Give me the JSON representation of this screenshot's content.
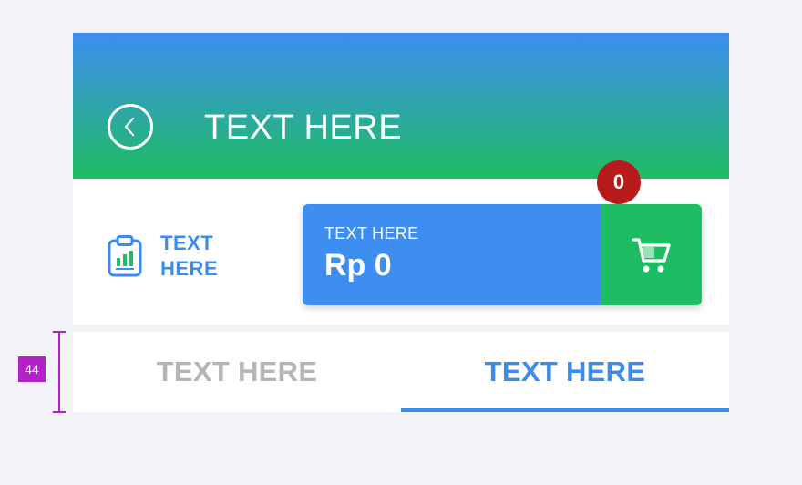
{
  "header": {
    "title": "TEXT HERE",
    "back_icon": "chevron-left-circle-icon",
    "gradient_top": "#3d8ef0",
    "gradient_bottom": "#1fbd63"
  },
  "report": {
    "icon": "clipboard-chart-icon",
    "label": "TEXT HERE"
  },
  "cart_summary": {
    "label": "TEXT HERE",
    "total": "Rp 0",
    "badge_count": "0",
    "cart_icon": "cart-icon"
  },
  "tabs": [
    {
      "label": "TEXT HERE",
      "active": false
    },
    {
      "label": "TEXT HERE",
      "active": true
    }
  ],
  "annotation": {
    "height_label": "44"
  },
  "colors": {
    "blue": "#3d8ef0",
    "green": "#1fbd63",
    "badge_red": "#b71b1b",
    "inactive_tab": "#b5b5b5",
    "measure": "#b321c9"
  }
}
